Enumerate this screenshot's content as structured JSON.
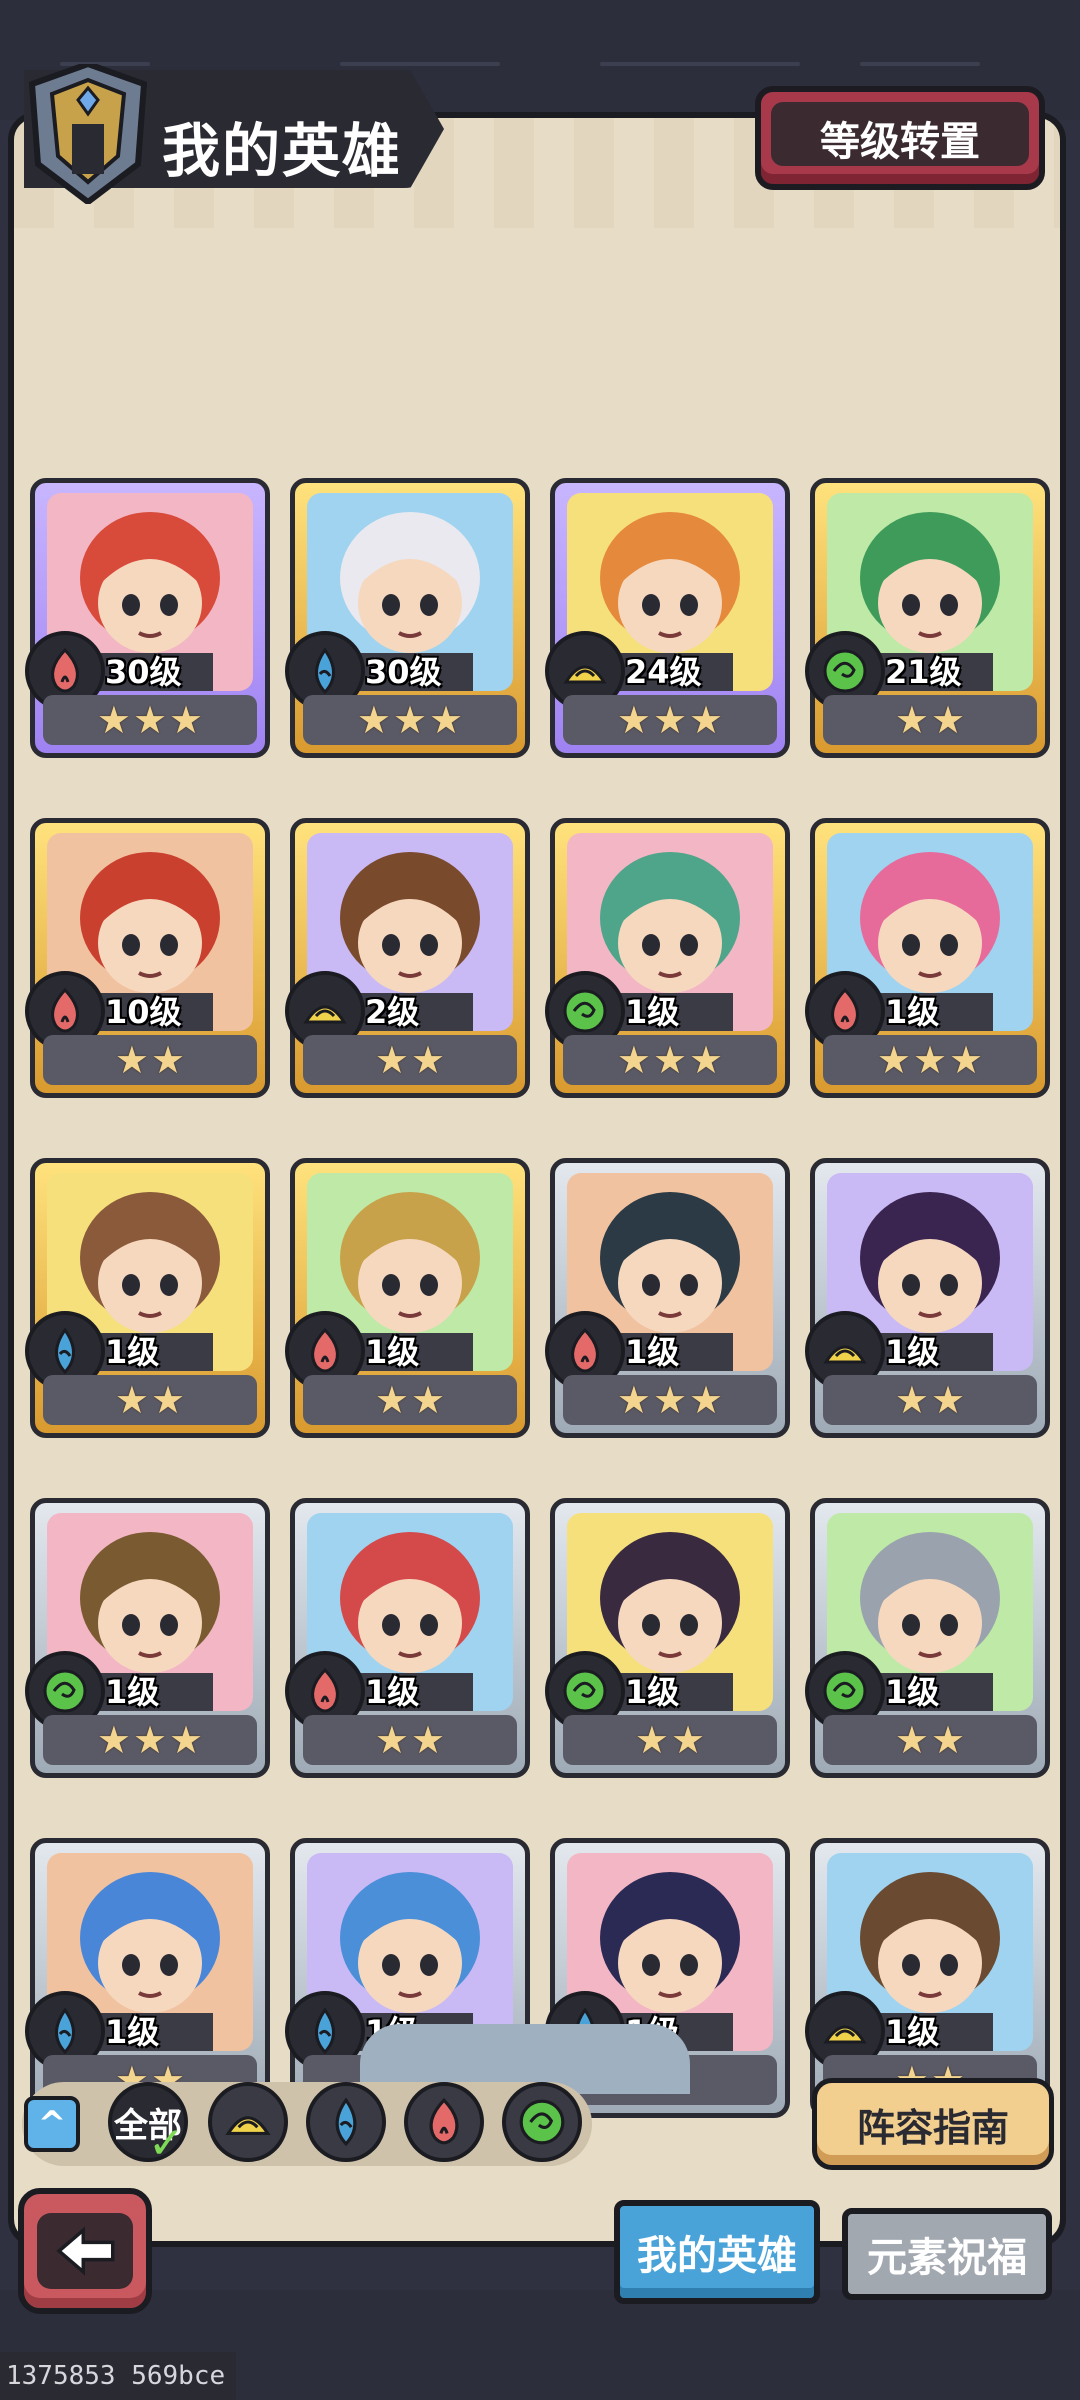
{
  "header": {
    "title": "我的英雄",
    "level_transfer_button": "等级转置"
  },
  "colors": {
    "fire": "#e36a68",
    "water": "#4aa3d8",
    "earth": "#f0d34a",
    "wind": "#5bc24a",
    "panel": "#e7dcc5",
    "dark": "#2a2a33"
  },
  "heroes": [
    {
      "level_label": "30级",
      "stars": 3,
      "element": "fire",
      "rarity": "purple",
      "portrait": "red-haired-girl-rose"
    },
    {
      "level_label": "30级",
      "stars": 3,
      "element": "water",
      "rarity": "gold",
      "portrait": "white-haired-girl-goggles"
    },
    {
      "level_label": "24级",
      "stars": 3,
      "element": "earth",
      "rarity": "purple",
      "portrait": "tiger-warrior"
    },
    {
      "level_label": "21级",
      "stars": 2,
      "element": "wind",
      "rarity": "gold",
      "portrait": "green-haired-man"
    },
    {
      "level_label": "10级",
      "stars": 2,
      "element": "fire",
      "rarity": "gold",
      "portrait": "red-haired-monocle-girl"
    },
    {
      "level_label": "2级",
      "stars": 2,
      "element": "earth",
      "rarity": "gold",
      "portrait": "dreadlock-man"
    },
    {
      "level_label": "1级",
      "stars": 3,
      "element": "wind",
      "rarity": "gold",
      "portrait": "green-elf-helmet"
    },
    {
      "level_label": "1级",
      "stars": 3,
      "element": "fire",
      "rarity": "gold",
      "portrait": "pink-haired-pilot"
    },
    {
      "level_label": "1级",
      "stars": 2,
      "element": "water",
      "rarity": "gold",
      "portrait": "wood-golem"
    },
    {
      "level_label": "1级",
      "stars": 2,
      "element": "fire",
      "rarity": "gold",
      "portrait": "golden-spartan"
    },
    {
      "level_label": "1级",
      "stars": 3,
      "element": "fire",
      "rarity": "silver",
      "portrait": "dark-haired-swordsman"
    },
    {
      "level_label": "1级",
      "stars": 2,
      "element": "earth",
      "rarity": "silver",
      "portrait": "purple-haired-woman"
    },
    {
      "level_label": "1级",
      "stars": 3,
      "element": "wind",
      "rarity": "silver",
      "portrait": "wooden-mask-creature"
    },
    {
      "level_label": "1级",
      "stars": 2,
      "element": "fire",
      "rarity": "silver",
      "portrait": "red-haired-elf"
    },
    {
      "level_label": "1级",
      "stars": 2,
      "element": "wind",
      "rarity": "silver",
      "portrait": "horned-dark-druid"
    },
    {
      "level_label": "1级",
      "stars": 2,
      "element": "wind",
      "rarity": "silver",
      "portrait": "armored-knight"
    },
    {
      "level_label": "1级",
      "stars": 2,
      "element": "water",
      "rarity": "silver",
      "portrait": "blue-haired-girl"
    },
    {
      "level_label": "1级",
      "stars": 2,
      "element": "water",
      "rarity": "silver",
      "portrait": "blue-dragon"
    },
    {
      "level_label": "1级",
      "stars": 1,
      "element": "water",
      "rarity": "silver",
      "portrait": "dark-haired-sorceress"
    },
    {
      "level_label": "1级",
      "stars": 2,
      "element": "earth",
      "rarity": "silver",
      "portrait": "bearded-warrior"
    }
  ],
  "filters": {
    "collapse_icon": "chevron-up-icon",
    "all_label": "全部",
    "elements": [
      "earth",
      "water",
      "fire",
      "wind"
    ]
  },
  "lineup_guide_button": "阵容指南",
  "tabs": {
    "my_heroes": "我的英雄",
    "element_blessing": "元素祝福"
  },
  "footer_id": "1375853 569bce"
}
